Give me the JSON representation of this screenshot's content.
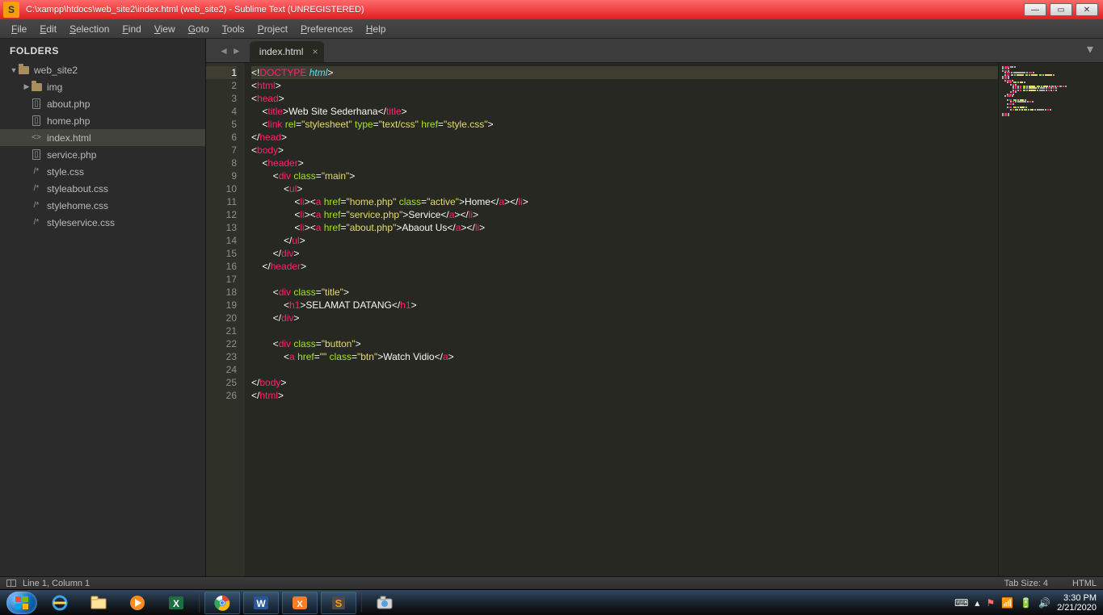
{
  "titlebar": {
    "appicon_letter": "S",
    "text": "C:\\xampp\\htdocs\\web_site2\\index.html (web_site2) - Sublime Text (UNREGISTERED)"
  },
  "menu": [
    "File",
    "Edit",
    "Selection",
    "Find",
    "View",
    "Goto",
    "Tools",
    "Project",
    "Preferences",
    "Help"
  ],
  "sidebar": {
    "header": "FOLDERS",
    "rows": [
      {
        "indent": 0,
        "type": "folder",
        "open": true,
        "label": "web_site2"
      },
      {
        "indent": 1,
        "type": "folder",
        "open": false,
        "label": "img"
      },
      {
        "indent": 1,
        "type": "php",
        "label": "about.php"
      },
      {
        "indent": 1,
        "type": "php",
        "label": "home.php"
      },
      {
        "indent": 1,
        "type": "html",
        "label": "index.html",
        "selected": true
      },
      {
        "indent": 1,
        "type": "php",
        "label": "service.php"
      },
      {
        "indent": 1,
        "type": "css",
        "label": "style.css"
      },
      {
        "indent": 1,
        "type": "css",
        "label": "styleabout.css"
      },
      {
        "indent": 1,
        "type": "css",
        "label": "stylehome.css"
      },
      {
        "indent": 1,
        "type": "css",
        "label": "styleservice.css"
      }
    ]
  },
  "tab": {
    "name": "index.html"
  },
  "gutter": {
    "active": 1,
    "count": 26
  },
  "code": [
    {
      "n": 1,
      "seg": [
        {
          "t": "<!",
          "c": "punct"
        },
        {
          "t": "DOCTYPE",
          "c": "dpink"
        },
        {
          "t": " html",
          "c": "doctype"
        },
        {
          "t": ">",
          "c": "punct"
        }
      ]
    },
    {
      "n": 2,
      "seg": [
        {
          "t": "<",
          "c": "punct"
        },
        {
          "t": "html",
          "c": "tag"
        },
        {
          "t": ">",
          "c": "punct"
        }
      ]
    },
    {
      "n": 3,
      "seg": [
        {
          "t": "<",
          "c": "punct"
        },
        {
          "t": "head",
          "c": "tag"
        },
        {
          "t": ">",
          "c": "punct"
        }
      ]
    },
    {
      "n": 4,
      "seg": [
        {
          "t": "    ",
          "c": "punct"
        },
        {
          "t": "<",
          "c": "punct"
        },
        {
          "t": "title",
          "c": "tag"
        },
        {
          "t": ">",
          "c": "punct"
        },
        {
          "t": "Web Site Sederhana",
          "c": "punct"
        },
        {
          "t": "</",
          "c": "punct"
        },
        {
          "t": "title",
          "c": "tag"
        },
        {
          "t": ">",
          "c": "punct"
        }
      ]
    },
    {
      "n": 5,
      "seg": [
        {
          "t": "    ",
          "c": "punct"
        },
        {
          "t": "<",
          "c": "punct"
        },
        {
          "t": "link",
          "c": "tag"
        },
        {
          "t": " ",
          "c": "punct"
        },
        {
          "t": "rel",
          "c": "attr"
        },
        {
          "t": "=",
          "c": "punct"
        },
        {
          "t": "\"stylesheet\"",
          "c": "str"
        },
        {
          "t": " ",
          "c": "punct"
        },
        {
          "t": "type",
          "c": "attr"
        },
        {
          "t": "=",
          "c": "punct"
        },
        {
          "t": "\"text/css\"",
          "c": "str"
        },
        {
          "t": " ",
          "c": "punct"
        },
        {
          "t": "href",
          "c": "attr"
        },
        {
          "t": "=",
          "c": "punct"
        },
        {
          "t": "\"style.css\"",
          "c": "str"
        },
        {
          "t": ">",
          "c": "punct"
        }
      ]
    },
    {
      "n": 6,
      "seg": [
        {
          "t": "</",
          "c": "punct"
        },
        {
          "t": "head",
          "c": "tag"
        },
        {
          "t": ">",
          "c": "punct"
        }
      ]
    },
    {
      "n": 7,
      "seg": [
        {
          "t": "<",
          "c": "punct"
        },
        {
          "t": "body",
          "c": "tag"
        },
        {
          "t": ">",
          "c": "punct"
        }
      ]
    },
    {
      "n": 8,
      "seg": [
        {
          "t": "    ",
          "c": "punct"
        },
        {
          "t": "<",
          "c": "punct"
        },
        {
          "t": "header",
          "c": "tag"
        },
        {
          "t": ">",
          "c": "punct"
        }
      ]
    },
    {
      "n": 9,
      "seg": [
        {
          "t": "        ",
          "c": "punct"
        },
        {
          "t": "<",
          "c": "punct"
        },
        {
          "t": "div",
          "c": "tag"
        },
        {
          "t": " ",
          "c": "punct"
        },
        {
          "t": "class",
          "c": "attr"
        },
        {
          "t": "=",
          "c": "punct"
        },
        {
          "t": "\"main\"",
          "c": "str"
        },
        {
          "t": ">",
          "c": "punct"
        }
      ]
    },
    {
      "n": 10,
      "seg": [
        {
          "t": "            ",
          "c": "punct"
        },
        {
          "t": "<",
          "c": "punct"
        },
        {
          "t": "ul",
          "c": "tag"
        },
        {
          "t": ">",
          "c": "punct"
        }
      ]
    },
    {
      "n": 11,
      "seg": [
        {
          "t": "                ",
          "c": "punct"
        },
        {
          "t": "<",
          "c": "punct"
        },
        {
          "t": "li",
          "c": "tag"
        },
        {
          "t": "><",
          "c": "punct"
        },
        {
          "t": "a",
          "c": "tag"
        },
        {
          "t": " ",
          "c": "punct"
        },
        {
          "t": "href",
          "c": "attr"
        },
        {
          "t": "=",
          "c": "punct"
        },
        {
          "t": "\"home.php\"",
          "c": "str"
        },
        {
          "t": " ",
          "c": "punct"
        },
        {
          "t": "class",
          "c": "attr"
        },
        {
          "t": "=",
          "c": "punct"
        },
        {
          "t": "\"active\"",
          "c": "str"
        },
        {
          "t": ">",
          "c": "punct"
        },
        {
          "t": "Home",
          "c": "punct"
        },
        {
          "t": "</",
          "c": "punct"
        },
        {
          "t": "a",
          "c": "tag"
        },
        {
          "t": "></",
          "c": "punct"
        },
        {
          "t": "li",
          "c": "tag"
        },
        {
          "t": ">",
          "c": "punct"
        }
      ]
    },
    {
      "n": 12,
      "seg": [
        {
          "t": "                ",
          "c": "punct"
        },
        {
          "t": "<",
          "c": "punct"
        },
        {
          "t": "li",
          "c": "tag"
        },
        {
          "t": "><",
          "c": "punct"
        },
        {
          "t": "a",
          "c": "tag"
        },
        {
          "t": " ",
          "c": "punct"
        },
        {
          "t": "href",
          "c": "attr"
        },
        {
          "t": "=",
          "c": "punct"
        },
        {
          "t": "\"service.php\"",
          "c": "str"
        },
        {
          "t": ">",
          "c": "punct"
        },
        {
          "t": "Service",
          "c": "punct"
        },
        {
          "t": "</",
          "c": "punct"
        },
        {
          "t": "a",
          "c": "tag"
        },
        {
          "t": "></",
          "c": "punct"
        },
        {
          "t": "li",
          "c": "tag"
        },
        {
          "t": ">",
          "c": "punct"
        }
      ]
    },
    {
      "n": 13,
      "seg": [
        {
          "t": "                ",
          "c": "punct"
        },
        {
          "t": "<",
          "c": "punct"
        },
        {
          "t": "li",
          "c": "tag"
        },
        {
          "t": "><",
          "c": "punct"
        },
        {
          "t": "a",
          "c": "tag"
        },
        {
          "t": " ",
          "c": "punct"
        },
        {
          "t": "href",
          "c": "attr"
        },
        {
          "t": "=",
          "c": "punct"
        },
        {
          "t": "\"about.php\"",
          "c": "str"
        },
        {
          "t": ">",
          "c": "punct"
        },
        {
          "t": "Abaout Us",
          "c": "punct"
        },
        {
          "t": "</",
          "c": "punct"
        },
        {
          "t": "a",
          "c": "tag"
        },
        {
          "t": "></",
          "c": "punct"
        },
        {
          "t": "li",
          "c": "tag"
        },
        {
          "t": ">",
          "c": "punct"
        }
      ]
    },
    {
      "n": 14,
      "seg": [
        {
          "t": "            ",
          "c": "punct"
        },
        {
          "t": "</",
          "c": "punct"
        },
        {
          "t": "ul",
          "c": "tag"
        },
        {
          "t": ">",
          "c": "punct"
        }
      ]
    },
    {
      "n": 15,
      "seg": [
        {
          "t": "        ",
          "c": "punct"
        },
        {
          "t": "</",
          "c": "punct"
        },
        {
          "t": "div",
          "c": "tag"
        },
        {
          "t": ">",
          "c": "punct"
        }
      ]
    },
    {
      "n": 16,
      "seg": [
        {
          "t": "    ",
          "c": "punct"
        },
        {
          "t": "</",
          "c": "punct"
        },
        {
          "t": "header",
          "c": "tag"
        },
        {
          "t": ">",
          "c": "punct"
        }
      ]
    },
    {
      "n": 17,
      "seg": []
    },
    {
      "n": 18,
      "seg": [
        {
          "t": "        ",
          "c": "punct"
        },
        {
          "t": "<",
          "c": "punct"
        },
        {
          "t": "div",
          "c": "tag"
        },
        {
          "t": " ",
          "c": "punct"
        },
        {
          "t": "class",
          "c": "attr"
        },
        {
          "t": "=",
          "c": "punct"
        },
        {
          "t": "\"title\"",
          "c": "str"
        },
        {
          "t": ">",
          "c": "punct"
        }
      ]
    },
    {
      "n": 19,
      "seg": [
        {
          "t": "            ",
          "c": "punct"
        },
        {
          "t": "<",
          "c": "punct"
        },
        {
          "t": "h1",
          "c": "tag"
        },
        {
          "t": ">",
          "c": "punct"
        },
        {
          "t": "SELAMAT DATANG",
          "c": "punct"
        },
        {
          "t": "</",
          "c": "punct"
        },
        {
          "t": "h1",
          "c": "tag"
        },
        {
          "t": ">",
          "c": "punct"
        }
      ]
    },
    {
      "n": 20,
      "seg": [
        {
          "t": "        ",
          "c": "punct"
        },
        {
          "t": "</",
          "c": "punct"
        },
        {
          "t": "div",
          "c": "tag"
        },
        {
          "t": ">",
          "c": "punct"
        }
      ]
    },
    {
      "n": 21,
      "seg": []
    },
    {
      "n": 22,
      "seg": [
        {
          "t": "        ",
          "c": "punct"
        },
        {
          "t": "<",
          "c": "punct"
        },
        {
          "t": "div",
          "c": "tag"
        },
        {
          "t": " ",
          "c": "punct"
        },
        {
          "t": "class",
          "c": "attr"
        },
        {
          "t": "=",
          "c": "punct"
        },
        {
          "t": "\"button\"",
          "c": "str"
        },
        {
          "t": ">",
          "c": "punct"
        }
      ]
    },
    {
      "n": 23,
      "seg": [
        {
          "t": "            ",
          "c": "punct"
        },
        {
          "t": "<",
          "c": "punct"
        },
        {
          "t": "a",
          "c": "tag"
        },
        {
          "t": " ",
          "c": "punct"
        },
        {
          "t": "href",
          "c": "attr"
        },
        {
          "t": "=",
          "c": "punct"
        },
        {
          "t": "\"\"",
          "c": "str"
        },
        {
          "t": " ",
          "c": "punct"
        },
        {
          "t": "class",
          "c": "attr"
        },
        {
          "t": "=",
          "c": "punct"
        },
        {
          "t": "\"btn\"",
          "c": "str"
        },
        {
          "t": ">",
          "c": "punct"
        },
        {
          "t": "Watch Vidio",
          "c": "punct"
        },
        {
          "t": "</",
          "c": "punct"
        },
        {
          "t": "a",
          "c": "tag"
        },
        {
          "t": ">",
          "c": "punct"
        }
      ]
    },
    {
      "n": 24,
      "seg": []
    },
    {
      "n": 25,
      "seg": [
        {
          "t": "</",
          "c": "punct"
        },
        {
          "t": "body",
          "c": "tag"
        },
        {
          "t": ">",
          "c": "punct"
        }
      ]
    },
    {
      "n": 26,
      "seg": [
        {
          "t": "</",
          "c": "punct"
        },
        {
          "t": "html",
          "c": "tag"
        },
        {
          "t": ">",
          "c": "punct"
        }
      ]
    }
  ],
  "status": {
    "left": "Line 1, Column 1",
    "tab": "Tab Size: 4",
    "lang": "HTML"
  },
  "tray": {
    "time": "3:30 PM",
    "date": "2/21/2020"
  }
}
